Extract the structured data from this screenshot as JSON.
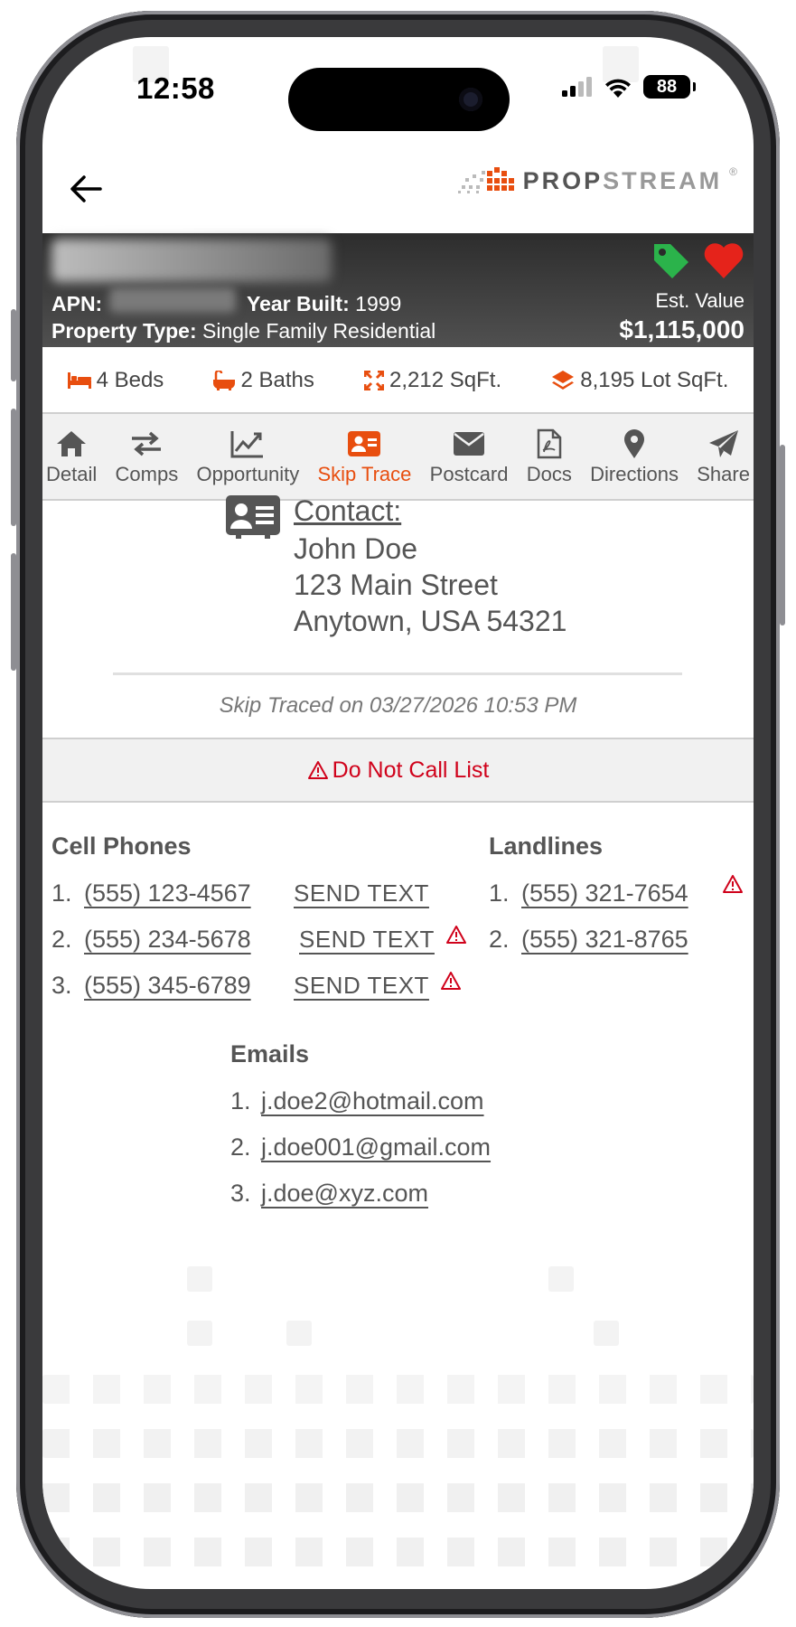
{
  "status_bar": {
    "time": "12:58",
    "battery": "88"
  },
  "header": {
    "logo_main": "PROP",
    "logo_light": "STREAM",
    "logo_mark": "®"
  },
  "property": {
    "apn_label": "APN:",
    "year_built_label": "Year Built:",
    "year_built": "1999",
    "property_type_label": "Property Type:",
    "property_type": "Single Family Residential",
    "est_value_label": "Est. Value",
    "est_value": "$1,115,000"
  },
  "facts": {
    "beds": "4 Beds",
    "baths": "2 Baths",
    "sqft": "2,212 SqFt.",
    "lot": "8,195 Lot SqFt."
  },
  "tabs": [
    {
      "label": "Detail"
    },
    {
      "label": "Comps"
    },
    {
      "label": "Opportunity"
    },
    {
      "label": "Skip Trace"
    },
    {
      "label": "Postcard"
    },
    {
      "label": "Docs"
    },
    {
      "label": "Directions"
    },
    {
      "label": "Share"
    }
  ],
  "contact": {
    "label": "Contact:",
    "name": "John Doe",
    "street": "123 Main Street",
    "city": "Anytown, USA 54321",
    "traced": "Skip Traced on 03/27/2026 10:53 PM"
  },
  "dnc": {
    "label": "Do Not Call List"
  },
  "cell_phones": {
    "title": "Cell Phones",
    "send_text_label": "SEND TEXT",
    "items": [
      {
        "num": "1.",
        "phone": "(555) 123-4567"
      },
      {
        "num": "2.",
        "phone": "(555) 234-5678"
      },
      {
        "num": "3.",
        "phone": "(555) 345-6789"
      }
    ]
  },
  "landlines": {
    "title": "Landlines",
    "items": [
      {
        "num": "1.",
        "phone": "(555) 321-7654"
      },
      {
        "num": "2.",
        "phone": "(555) 321-8765"
      }
    ]
  },
  "emails": {
    "title": "Emails",
    "items": [
      {
        "num": "1.",
        "email": "j.doe2@hotmail.com"
      },
      {
        "num": "2.",
        "email": "j.doe001@gmail.com"
      },
      {
        "num": "3.",
        "email": "j.doe@xyz.com"
      }
    ]
  },
  "colors": {
    "accent": "#e84e0f",
    "warning": "#d0021b",
    "tag": "#2bb34b",
    "heart": "#e5231b"
  }
}
